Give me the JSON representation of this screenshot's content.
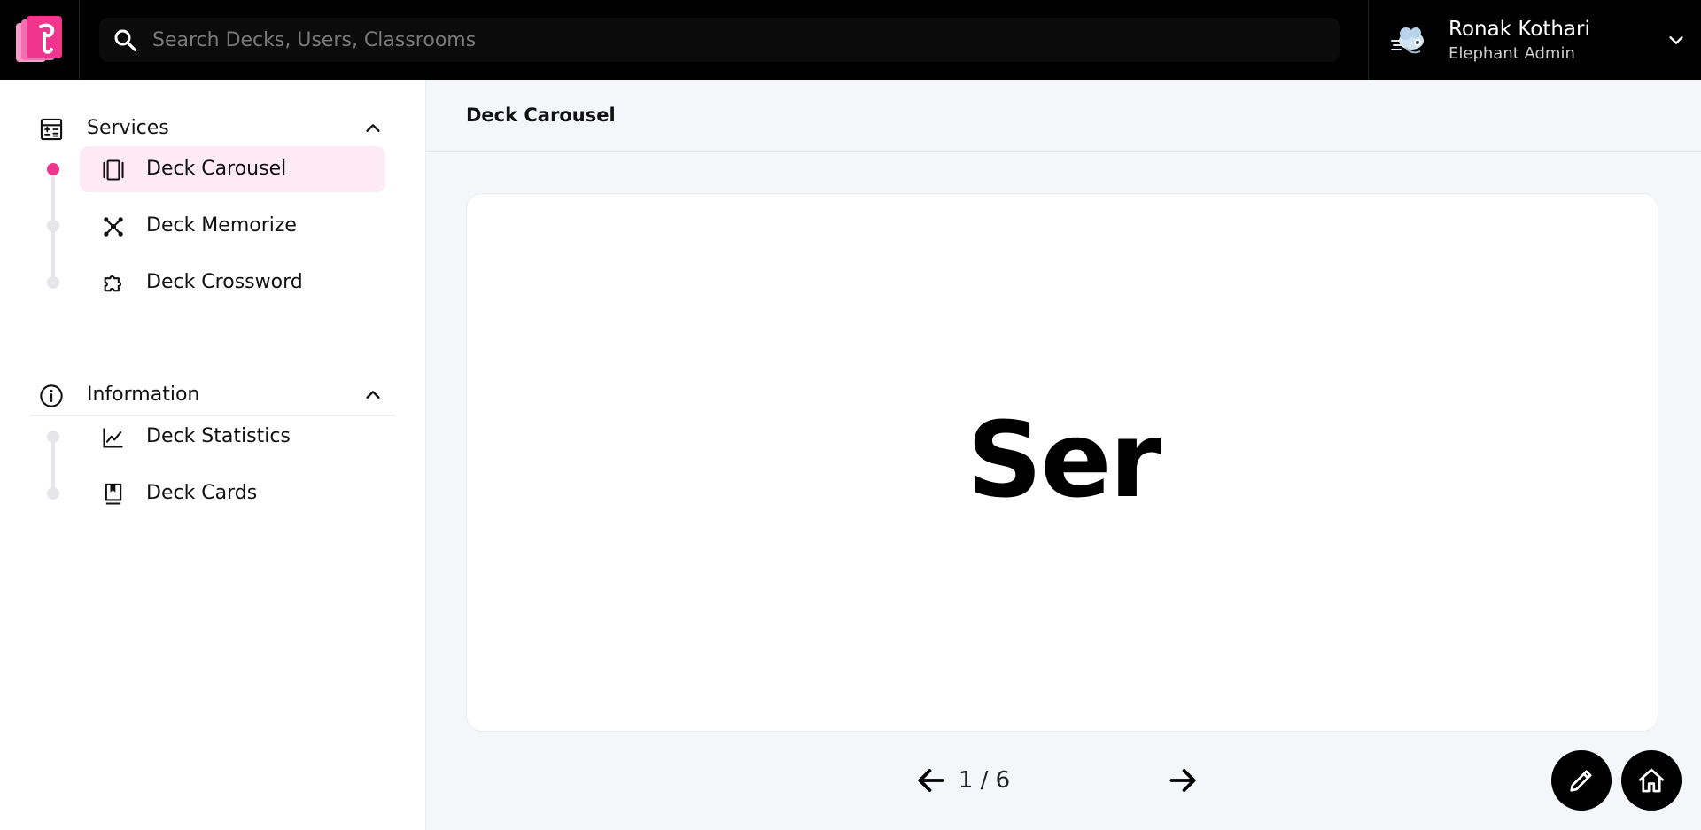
{
  "header": {
    "search_placeholder": "Search Decks, Users, Classrooms",
    "user_name": "Ronak Kothari",
    "user_role": "Elephant Admin"
  },
  "sidebar": {
    "sections": [
      {
        "title": "Services",
        "icon": "calculator-icon",
        "expanded": true,
        "items": [
          {
            "label": "Deck Carousel",
            "icon": "carousel-icon",
            "active": true
          },
          {
            "label": "Deck Memorize",
            "icon": "hub-icon",
            "active": false
          },
          {
            "label": "Deck Crossword",
            "icon": "puzzle-icon",
            "active": false
          }
        ]
      },
      {
        "title": "Information",
        "icon": "info-icon",
        "expanded": true,
        "items": [
          {
            "label": "Deck Statistics",
            "icon": "chart-line-icon",
            "active": false
          },
          {
            "label": "Deck Cards",
            "icon": "bookmark-book-icon",
            "active": false
          }
        ]
      }
    ]
  },
  "main": {
    "title": "Deck Carousel",
    "card_text": "Ser",
    "pager": {
      "current": 1,
      "total": 6,
      "text": "1 / 6"
    }
  },
  "colors": {
    "accent": "#f0358f",
    "active_bg": "#fdeaf4",
    "topbar": "#000000",
    "main_bg": "#f5f6f9"
  }
}
